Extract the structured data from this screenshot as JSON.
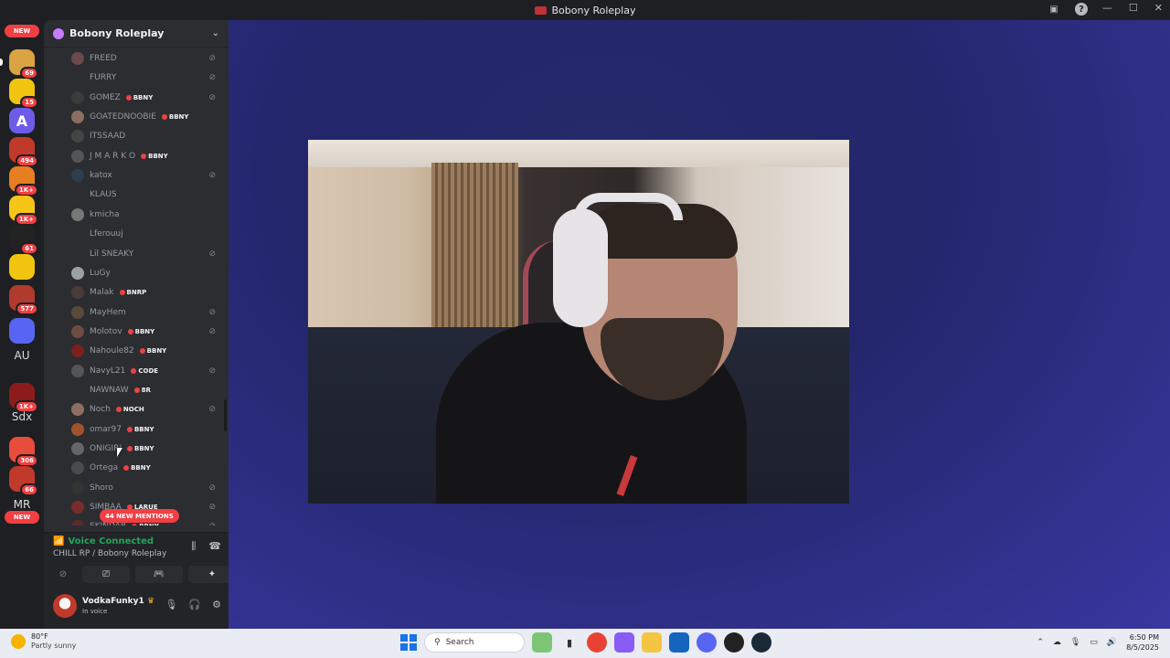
{
  "window": {
    "title": "Bobony Roleplay"
  },
  "rail": {
    "top_pill": "NEW",
    "bottom_pill": "NEW",
    "servers": [
      {
        "badge": "69",
        "color": "#d9a441"
      },
      {
        "badge": "15",
        "color": "#f1c40f"
      },
      {
        "badge": "",
        "color": "#6c5ce7",
        "letter": "A"
      },
      {
        "badge": "494",
        "color": "#c0392b"
      },
      {
        "badge": "1K+",
        "color": "#e67e22"
      },
      {
        "badge": "1K+",
        "color": "#f5c518"
      },
      {
        "badge": "61",
        "color": "#222"
      },
      {
        "badge": "",
        "color": "#f1c40f"
      },
      {
        "badge": "577",
        "color": "#b03a2e"
      },
      {
        "badge": "",
        "color": "#5865f2"
      },
      {
        "badge": "1K+",
        "color": "#8e1b1b"
      },
      {
        "badge": "306",
        "color": "#e74c3c"
      },
      {
        "badge": "66",
        "color": "#c0392b"
      }
    ],
    "texts": {
      "au": "AU",
      "sdx": "Sdx",
      "mr": "MR"
    }
  },
  "guild": {
    "name": "Bobony Roleplay"
  },
  "members": [
    {
      "name": "FREED",
      "tag": "",
      "muted": true,
      "avatar": "#6b4a4a"
    },
    {
      "name": "FURRY",
      "tag": "",
      "muted": true,
      "avatar": ""
    },
    {
      "name": "GOMEZ",
      "tag": "BBNY",
      "muted": true,
      "avatar": "#3b3b3b"
    },
    {
      "name": "GOATEDNOOBIE",
      "tag": "BBNY",
      "muted": false,
      "avatar": "#8d6e63"
    },
    {
      "name": "ITSSAAD",
      "tag": "",
      "muted": false,
      "avatar": "#444"
    },
    {
      "name": "J M A R K O",
      "tag": "BBNY",
      "muted": false,
      "avatar": "#555"
    },
    {
      "name": "katox",
      "tag": "",
      "muted": true,
      "avatar": "#2c3e50"
    },
    {
      "name": "KLAUS",
      "tag": "",
      "muted": false,
      "avatar": ""
    },
    {
      "name": "kmicha",
      "tag": "",
      "muted": false,
      "avatar": "#777"
    },
    {
      "name": "Lferouuj",
      "tag": "",
      "muted": false,
      "avatar": ""
    },
    {
      "name": "Lil SNEAKY",
      "tag": "",
      "muted": true,
      "avatar": ""
    },
    {
      "name": "LuGy",
      "tag": "",
      "muted": false,
      "avatar": "#9aa0a6"
    },
    {
      "name": "Malak",
      "tag": "BNRP",
      "muted": false,
      "avatar": "#4a3b3b"
    },
    {
      "name": "MayHem",
      "tag": "",
      "muted": true,
      "avatar": "#5a4a3a"
    },
    {
      "name": "Molotov",
      "tag": "BBNY",
      "muted": true,
      "avatar": "#6d4c41"
    },
    {
      "name": "Nahoule82",
      "tag": "BBNY",
      "muted": false,
      "avatar": "#7b1f1f"
    },
    {
      "name": "NavyL21",
      "tag": "CODE",
      "muted": true,
      "avatar": "#555"
    },
    {
      "name": "NAWNAW",
      "tag": "8R",
      "muted": false,
      "avatar": ""
    },
    {
      "name": "Noch",
      "tag": "NOCH",
      "muted": true,
      "avatar": "#8d6e63"
    },
    {
      "name": "omar97",
      "tag": "BBNY",
      "muted": false,
      "avatar": "#a0522d"
    },
    {
      "name": "ONIGIRI",
      "tag": "BBNY",
      "muted": false,
      "avatar": "#666"
    },
    {
      "name": "Ortega",
      "tag": "BBNY",
      "muted": false,
      "avatar": "#4b4b4b"
    },
    {
      "name": "Shoro",
      "tag": "",
      "muted": true,
      "avatar": "#333"
    },
    {
      "name": "SIMBAA",
      "tag": "LARUE",
      "muted": true,
      "avatar": "#7a2b2b"
    },
    {
      "name": "SKINDAR",
      "tag": "BBNY",
      "muted": true,
      "avatar": "#5a2b2b"
    }
  ],
  "mentions_pill": "44 NEW MENTIONS",
  "voice": {
    "status": "Voice Connected",
    "channel": "CHILL RP / Bobony Roleplay"
  },
  "user": {
    "name": "VodkaFunky1",
    "status": "In voice"
  },
  "taskbar": {
    "weather_temp": "80°F",
    "weather_cond": "Partly sunny",
    "search_placeholder": "Search",
    "time": "6:50 PM",
    "date": "8/5/2025"
  }
}
